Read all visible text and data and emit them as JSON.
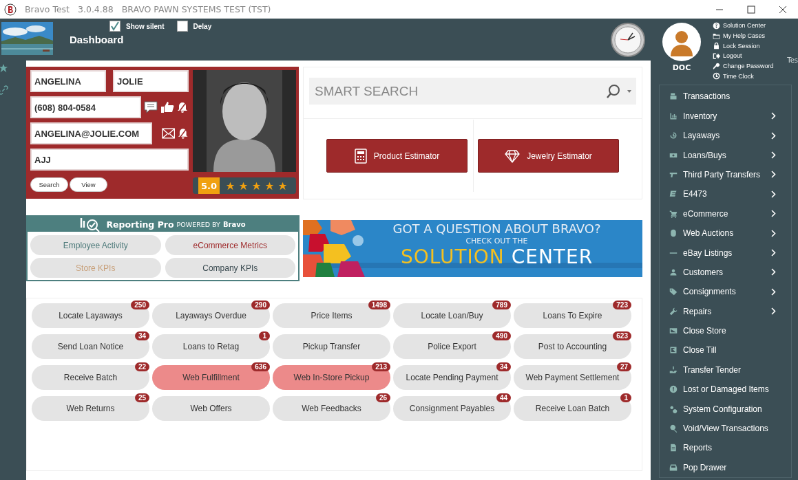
{
  "window": {
    "title": "Bravo Test",
    "version": "3.0.4.88",
    "subtitle": "BRAVO PAWN SYSTEMS TEST (TST)"
  },
  "header": {
    "options": [
      {
        "label": "Show silent",
        "checked": true
      },
      {
        "label": "Delay",
        "checked": false
      }
    ],
    "title": "Dashboard"
  },
  "user": {
    "name": "DOC",
    "links": [
      "Solution Center",
      "My Help Cases",
      "Lock Session",
      "Logout",
      "Change Password",
      "Time Clock"
    ],
    "edge_text": "Tes"
  },
  "customer": {
    "first_name": "ANGELINA",
    "last_name": "JOLIE",
    "phone": "(608) 804-0584",
    "email": "ANGELINA@JOLIE.COM",
    "initials": "AJJ",
    "buttons": [
      "Search",
      "View"
    ],
    "rating": "5.0",
    "stars": 5
  },
  "search": {
    "placeholder": "SMART SEARCH",
    "buttons": [
      "Product Estimator",
      "Jewelry Estimator"
    ]
  },
  "reporting": {
    "title": "Reporting Pro",
    "powered": "POWERED BY",
    "brand": "Bravo",
    "buttons": [
      {
        "label": "Employee Activity",
        "color": "#4d7a7a"
      },
      {
        "label": "eCommerce Metrics",
        "color": "#9e2a2b"
      },
      {
        "label": "Store KPIs",
        "color": "#c8a07a"
      },
      {
        "label": "Company KPIs",
        "color": "#3a4a50"
      }
    ]
  },
  "banner": {
    "line1": "GOT A QUESTION ABOUT BRAVO?",
    "line2": "CHECK OUT THE",
    "line3a": "SOLUTION",
    "line3b": "CENTER"
  },
  "tasks": [
    {
      "label": "Locate Layaways",
      "count": "250",
      "alert": false
    },
    {
      "label": "Layaways Overdue",
      "count": "290",
      "alert": false
    },
    {
      "label": "Price Items",
      "count": "1498",
      "alert": false
    },
    {
      "label": "Locate Loan/Buy",
      "count": "789",
      "alert": false
    },
    {
      "label": "Loans To Expire",
      "count": "723",
      "alert": false
    },
    {
      "label": "Send Loan Notice",
      "count": "34",
      "alert": false
    },
    {
      "label": "Loans to Retag",
      "count": "1",
      "alert": false
    },
    {
      "label": "Pickup Transfer",
      "alert": false
    },
    {
      "label": "Police Export",
      "count": "490",
      "alert": false
    },
    {
      "label": "Post to Accounting",
      "count": "623",
      "alert": false
    },
    {
      "label": "Receive Batch",
      "count": "22",
      "alert": false
    },
    {
      "label": "Web Fulfillment",
      "count": "636",
      "alert": true
    },
    {
      "label": "Web In-Store Pickup",
      "count": "213",
      "alert": true
    },
    {
      "label": "Locate Pending Payment",
      "count": "34",
      "alert": false
    },
    {
      "label": "Web Payment Settlement",
      "count": "27",
      "alert": false
    },
    {
      "label": "Web Returns",
      "count": "25",
      "alert": false
    },
    {
      "label": "Web Offers",
      "alert": false
    },
    {
      "label": "Web Feedbacks",
      "count": "26",
      "alert": false
    },
    {
      "label": "Consignment Payables",
      "count": "44",
      "alert": false
    },
    {
      "label": "Receive Loan Batch",
      "count": "1",
      "alert": false
    }
  ],
  "menu": [
    {
      "label": "Transactions",
      "submenu": false
    },
    {
      "label": "Inventory",
      "submenu": true
    },
    {
      "label": "Layaways",
      "submenu": true
    },
    {
      "label": "Loans/Buys",
      "submenu": true
    },
    {
      "label": "Third Party Transfers",
      "submenu": true
    },
    {
      "label": "E4473",
      "submenu": true
    },
    {
      "label": "eCommerce",
      "submenu": true
    },
    {
      "label": "Web Auctions",
      "submenu": true
    },
    {
      "label": "eBay Listings",
      "submenu": true
    },
    {
      "label": "Customers",
      "submenu": true
    },
    {
      "label": "Consignments",
      "submenu": true
    },
    {
      "label": "Repairs",
      "submenu": true
    },
    {
      "label": "Close Store",
      "submenu": false
    },
    {
      "label": "Close Till",
      "submenu": false
    },
    {
      "label": "Transfer Tender",
      "submenu": false
    },
    {
      "label": "Lost or Damaged Items",
      "submenu": false
    },
    {
      "label": "System Configuration",
      "submenu": false
    },
    {
      "label": "Void/View Transactions",
      "submenu": false
    },
    {
      "label": "Reports",
      "submenu": false
    },
    {
      "label": "Pop Drawer",
      "submenu": false
    }
  ]
}
